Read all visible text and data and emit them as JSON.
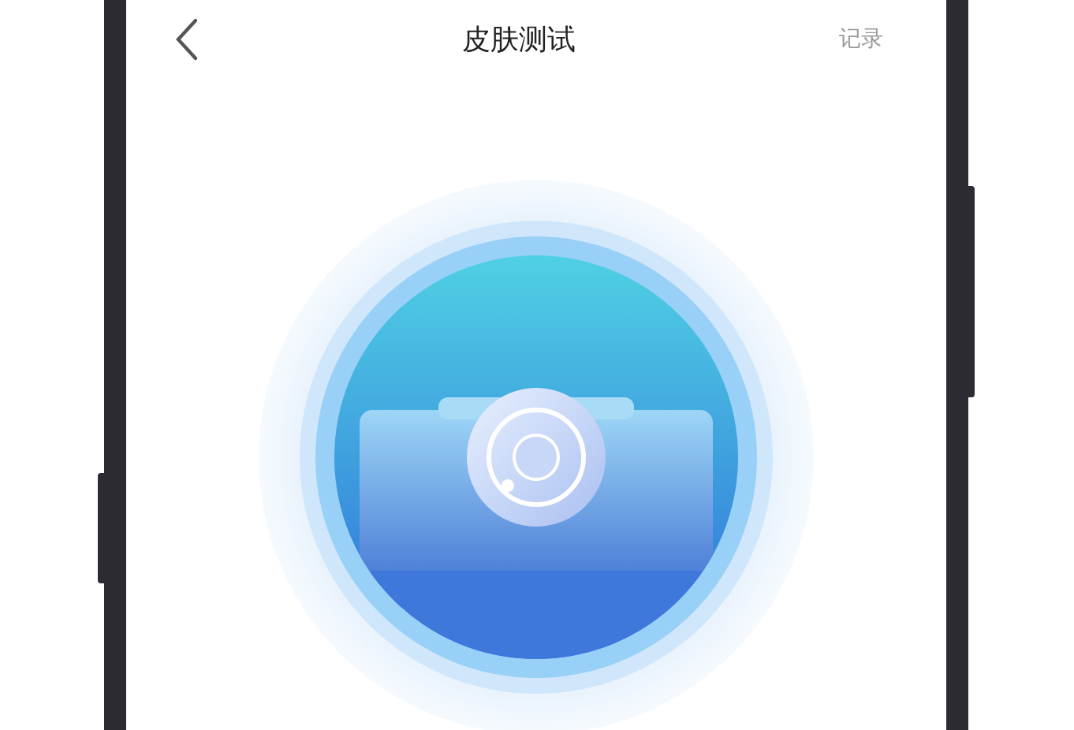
{
  "header": {
    "title": "皮肤测试",
    "action": "记录"
  }
}
